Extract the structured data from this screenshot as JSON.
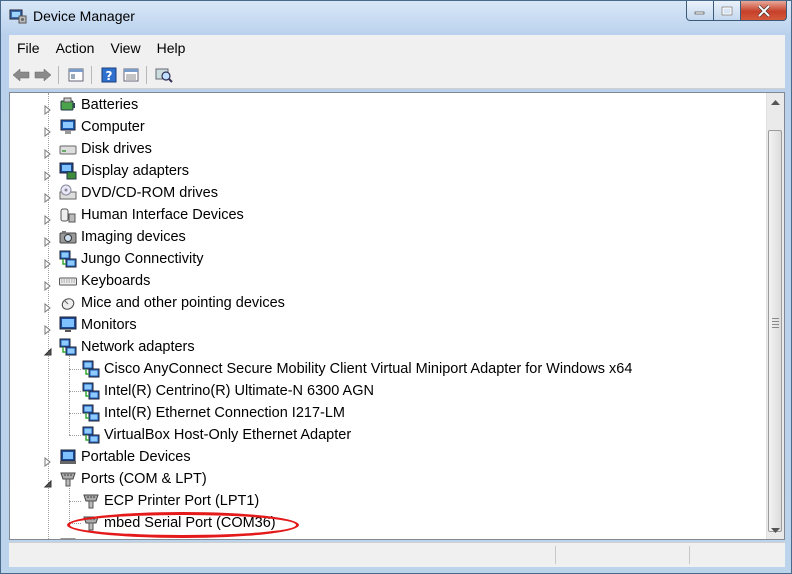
{
  "window": {
    "title": "Device Manager"
  },
  "menu": [
    "File",
    "Action",
    "View",
    "Help"
  ],
  "toolbar": {
    "icons": [
      "back-icon",
      "forward-icon",
      "properties-icon",
      "help-icon",
      "view-icon",
      "scan-hardware-icon"
    ]
  },
  "tree": {
    "categories": [
      {
        "label": "Batteries",
        "icon": "battery-icon",
        "expanded": false
      },
      {
        "label": "Computer",
        "icon": "computer-icon",
        "expanded": false
      },
      {
        "label": "Disk drives",
        "icon": "disk-drive-icon",
        "expanded": false
      },
      {
        "label": "Display adapters",
        "icon": "display-adapter-icon",
        "expanded": false
      },
      {
        "label": "DVD/CD-ROM drives",
        "icon": "dvd-drive-icon",
        "expanded": false
      },
      {
        "label": "Human Interface Devices",
        "icon": "hid-icon",
        "expanded": false
      },
      {
        "label": "Imaging devices",
        "icon": "camera-icon",
        "expanded": false
      },
      {
        "label": "Jungo Connectivity",
        "icon": "network-icon",
        "expanded": false
      },
      {
        "label": "Keyboards",
        "icon": "keyboard-icon",
        "expanded": false
      },
      {
        "label": "Mice and other pointing devices",
        "icon": "mouse-icon",
        "expanded": false
      },
      {
        "label": "Monitors",
        "icon": "monitor-icon",
        "expanded": false
      },
      {
        "label": "Network adapters",
        "icon": "network-icon",
        "expanded": true,
        "children": [
          "Cisco AnyConnect Secure Mobility Client Virtual Miniport Adapter for Windows x64",
          "Intel(R) Centrino(R) Ultimate-N 6300 AGN",
          "Intel(R) Ethernet Connection I217-LM",
          "VirtualBox Host-Only Ethernet Adapter"
        ]
      },
      {
        "label": "Portable Devices",
        "icon": "portable-device-icon",
        "expanded": false
      },
      {
        "label": "Ports (COM & LPT)",
        "icon": "port-icon",
        "expanded": true,
        "children": [
          "ECP Printer Port (LPT1)",
          "mbed Serial Port (COM36)"
        ]
      }
    ],
    "partial_next": "P"
  },
  "annotation": {
    "highlighted_item": "mbed Serial Port (COM36)",
    "color": "#e41919"
  },
  "colors": {
    "title_bg": "#bcd3ee",
    "tree_bg": "#ffffff",
    "close_btn": "#c6402a"
  }
}
